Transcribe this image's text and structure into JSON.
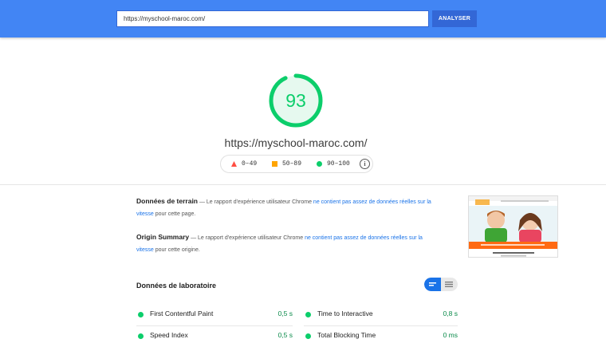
{
  "search": {
    "url_value": "https://myschool-maroc.com/",
    "analyze_label": "ANALYSER"
  },
  "score": {
    "value": "93",
    "fraction": 0.93,
    "color": "#0cce6b",
    "site_url": "https://myschool-maroc.com/"
  },
  "legend": {
    "fail": "0–49",
    "average": "50–89",
    "pass": "90–100",
    "info_icon": "i",
    "colors": {
      "fail": "#ff4e42",
      "average": "#ffa400",
      "pass": "#0cce6b"
    }
  },
  "field_data": {
    "title": "Données de terrain",
    "prefix": " — Le rapport d'expérience utilisateur Chrome ",
    "link": "ne contient pas assez de données réelles sur la vitesse",
    "suffix": " pour cette page."
  },
  "origin_summary": {
    "title": "Origin Summary",
    "prefix": " — Le rapport d'expérience utilisateur Chrome ",
    "link": "ne contient pas assez de données réelles sur la vitesse",
    "suffix": " pour cette origine."
  },
  "lab": {
    "title": "Données de laboratoire",
    "metrics_left": [
      {
        "name": "First Contentful Paint",
        "value": "0,5 s"
      },
      {
        "name": "Speed Index",
        "value": "0,5 s"
      }
    ],
    "metrics_right": [
      {
        "name": "Time to Interactive",
        "value": "0,8 s"
      },
      {
        "name": "Total Blocking Time",
        "value": "0 ms"
      }
    ]
  }
}
